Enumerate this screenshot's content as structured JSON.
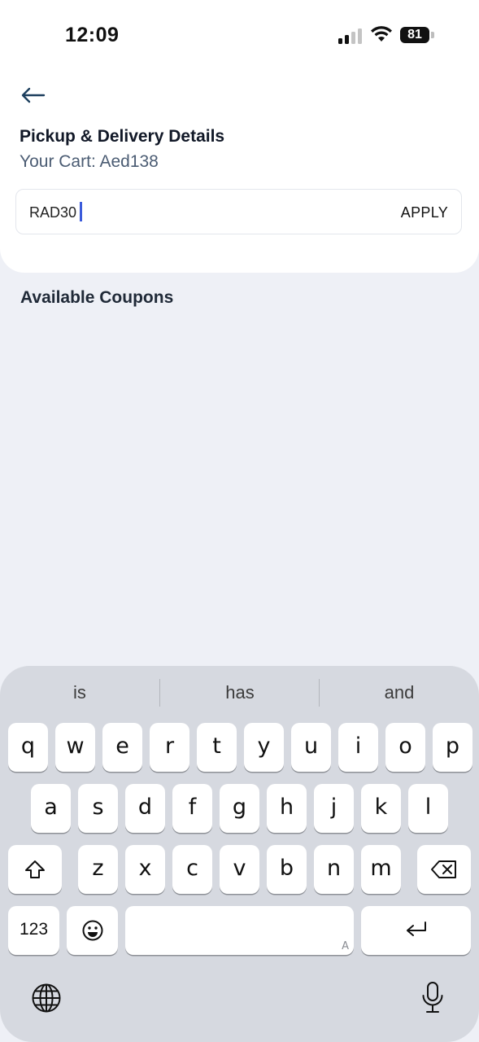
{
  "status_bar": {
    "time": "12:09",
    "battery": "81"
  },
  "header": {
    "title": "Pickup & Delivery Details",
    "cart_summary": "Your Cart: Aed138"
  },
  "coupon": {
    "value": "RAD30",
    "apply_label": "APPLY"
  },
  "section": {
    "available_title": "Available Coupons"
  },
  "keyboard": {
    "suggestions": [
      "is",
      "has",
      "and"
    ],
    "row1": [
      "q",
      "w",
      "e",
      "r",
      "t",
      "y",
      "u",
      "i",
      "o",
      "p"
    ],
    "row2": [
      "a",
      "s",
      "d",
      "f",
      "g",
      "h",
      "j",
      "k",
      "l"
    ],
    "row3": [
      "z",
      "x",
      "c",
      "v",
      "b",
      "n",
      "m"
    ],
    "numbers_label": "123",
    "space_mark": "A"
  },
  "icons": {
    "back": "arrow-left-icon",
    "shift": "shift-icon",
    "delete": "backspace-icon",
    "emoji": "emoji-icon",
    "return": "return-icon",
    "globe": "globe-icon",
    "mic": "microphone-icon"
  }
}
